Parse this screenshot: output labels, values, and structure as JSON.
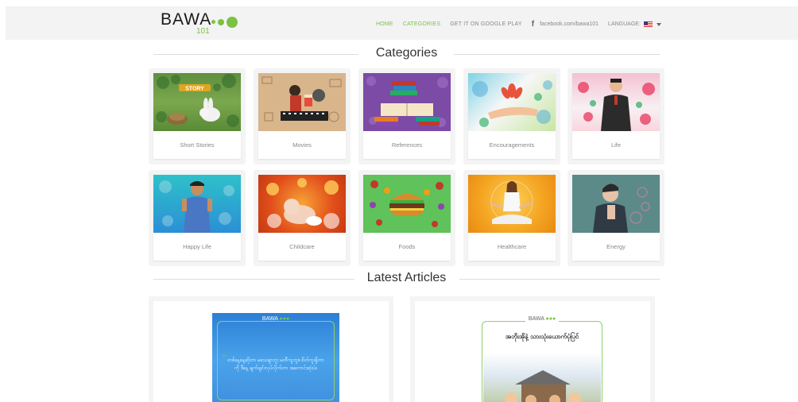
{
  "header": {
    "logo_text": "BAWA",
    "logo_sub": "101",
    "brand_color": "#7cc242",
    "nav": {
      "home": "HOME",
      "categories": "CATEGORIES",
      "google_play": "GET IT ON GOOGLE PLAY",
      "facebook_icon": "f",
      "facebook": "facebook.com/bawa101",
      "language": "LANGUAGE:"
    }
  },
  "categories_title": "Categories",
  "categories": [
    {
      "label": "Short Stories",
      "icon": "story-rabbit-illustration"
    },
    {
      "label": "Movies",
      "icon": "movies-illustration"
    },
    {
      "label": "References",
      "icon": "books-illustration"
    },
    {
      "label": "Encouragements",
      "icon": "lotus-hand-illustration"
    },
    {
      "label": "Life",
      "icon": "man-suit-illustration"
    },
    {
      "label": "Happy Life",
      "icon": "happy-boy-illustration"
    },
    {
      "label": "Childcare",
      "icon": "baby-illustration"
    },
    {
      "label": "Foods",
      "icon": "burger-illustration"
    },
    {
      "label": "Healthcare",
      "icon": "yoga-illustration"
    },
    {
      "label": "Energy",
      "icon": "tired-man-illustration"
    }
  ],
  "articles_title": "Latest Articles",
  "articles": [
    {
      "logo": "BAWA",
      "text": "တစ်နေ့နေ့ဆိုတာ မသေချာဘူး မတီကျဘူး။ စိတ်ကူးရှိတာကို ဒီနေ့ ချက်ချင်းလုပ်လိုက်တာ အကောင်းဆုံးပဲ။",
      "icon": "quote-poster"
    },
    {
      "logo": "BAWA",
      "text": "အဘိုးအိုနဲ့ သားသုံးယောက်ပုံပြင်",
      "icon": "farm-story-poster"
    }
  ]
}
